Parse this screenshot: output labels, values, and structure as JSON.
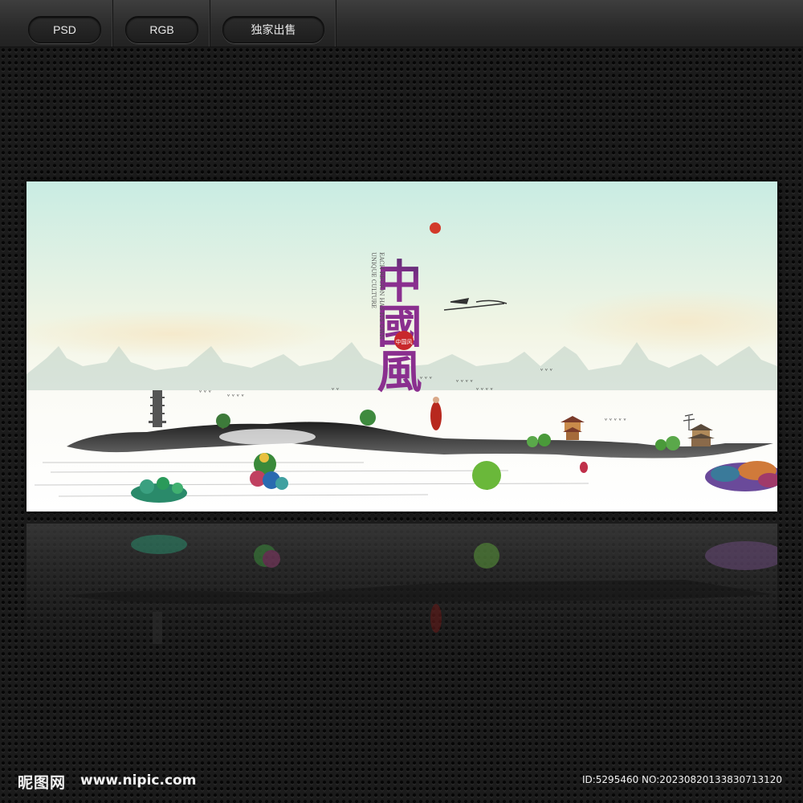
{
  "toolbar": {
    "badges": [
      {
        "label": "PSD"
      },
      {
        "label": "RGB"
      },
      {
        "label": "独家出售"
      }
    ]
  },
  "poster": {
    "calligraphy": "中國風",
    "vertical_text_1": "EACH REGION HAS ITS OWN",
    "vertical_text_2": "UNIQUE CULTURE",
    "seal_text": "中国风",
    "palette": {
      "sky_top": "#cdeee6",
      "sky_mid": "#f4f6e8",
      "ink": "#2a2a2a",
      "mist": "#ffffff"
    }
  },
  "footer": {
    "brand": "昵图网",
    "url": "www.nipic.com",
    "id_text": "ID:5295460 NO:20230820133830713120"
  }
}
